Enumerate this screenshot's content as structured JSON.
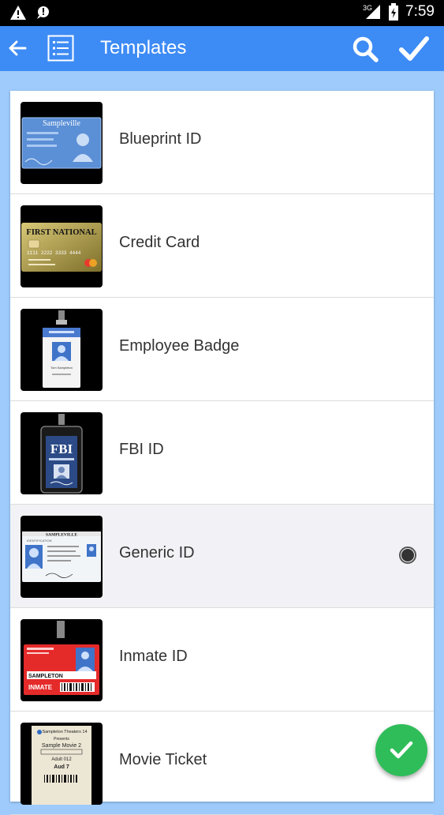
{
  "status_bar": {
    "time": "7:59",
    "network": "3G",
    "icons": [
      "warning-icon",
      "notification-icon",
      "signal-icon",
      "battery-icon"
    ]
  },
  "app_bar": {
    "title": "Templates",
    "icons": [
      "back-arrow-icon",
      "list-icon",
      "search-icon",
      "checkmark-icon"
    ]
  },
  "templates": [
    {
      "label": "Blueprint ID",
      "selected": false
    },
    {
      "label": "Credit Card",
      "selected": false
    },
    {
      "label": "Employee Badge",
      "selected": false
    },
    {
      "label": "FBI ID",
      "selected": false
    },
    {
      "label": "Generic ID",
      "selected": true
    },
    {
      "label": "Inmate ID",
      "selected": false
    },
    {
      "label": "Movie Ticket",
      "selected": false
    }
  ],
  "thumbnails": {
    "blueprint": "Sampleville",
    "credit_card_bank": "FIRST NATIONAL",
    "credit_card_number": "1111 2222 3333 4444",
    "employee_name": "Tom Sampleton",
    "fbi": "FBI",
    "generic_city": "SAMPLEVILLE",
    "generic_type": "IDENTIFICATION",
    "inmate_name": "SAMPLETON",
    "inmate_tag": "INMATE",
    "ticket_theater": "Sampleton Theaters 14",
    "ticket_presents": "Presents",
    "ticket_movie": "Sample Movie 2",
    "ticket_adult": "Adult 012",
    "ticket_aud": "Aud 7"
  },
  "colors": {
    "app_bar": "#3d8bf5",
    "background": "#9ecbfb",
    "fab": "#2fbd59"
  },
  "fab": {
    "icon": "checkmark-icon"
  }
}
